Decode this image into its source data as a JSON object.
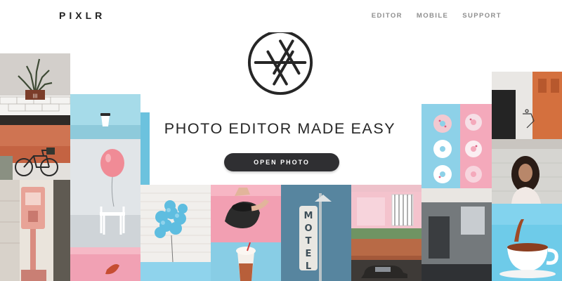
{
  "brand": {
    "name": "PIXLR"
  },
  "nav": {
    "items": [
      "EDITOR",
      "MOBILE",
      "SUPPORT"
    ]
  },
  "hero": {
    "icon": "camera-aperture-icon",
    "headline": "PHOTO EDITOR MADE EASY",
    "cta_label": "OPEN PHOTO"
  },
  "collage": {
    "photos": [
      "plant-on-brick-wall",
      "bicycle-by-brick-wall",
      "pink-parking-meter",
      "coffee-cup-on-blue-wall",
      "pink-balloon-and-chair",
      "pink-wall-corner",
      "aqua-wall",
      "blue-balloons-on-brick-wall",
      "hand-with-coffee-cup",
      "milkshake-glass",
      "motel-neon-sign",
      "pink-building-facade",
      "vintage-car-and-building",
      "donuts-on-pink-and-blue",
      "rooftop-street-scene",
      "woman-portrait",
      "clothing-rack",
      "coffee-cup-on-blue"
    ]
  },
  "colors": {
    "dark_text": "#222222",
    "nav_text": "#8e8e8e",
    "button_bg": "#2f2f32",
    "button_text": "#ffffff",
    "pink": "#f3a3b6",
    "sky_blue": "#7fcbe2",
    "brick": "#c86a46"
  }
}
